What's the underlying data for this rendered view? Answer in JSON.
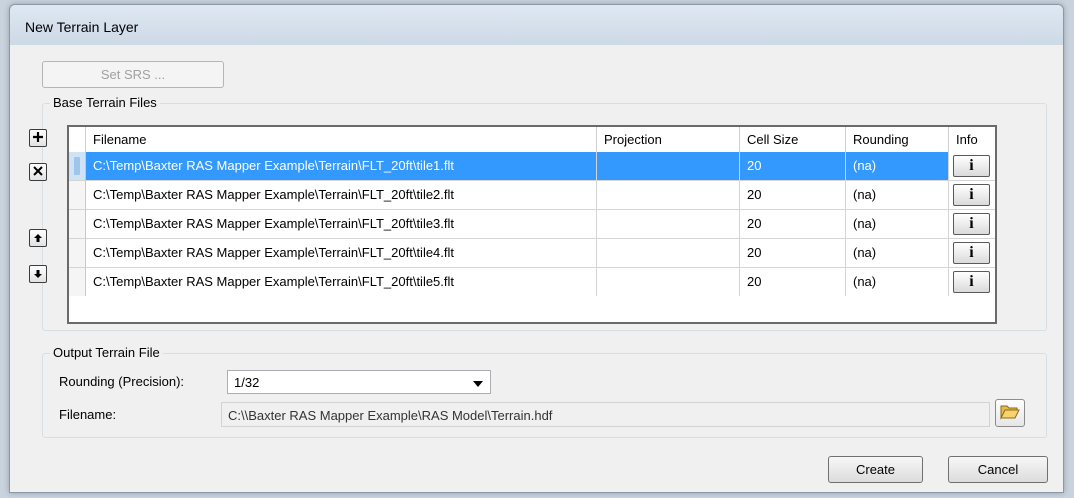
{
  "window": {
    "title": "New Terrain Layer"
  },
  "set_srs_label": "Set SRS ...",
  "base_terrain": {
    "group_label": "Base Terrain Files",
    "columns": [
      "Filename",
      "Projection",
      "Cell Size",
      "Rounding",
      "Info"
    ],
    "rows": [
      {
        "filename": "C:\\Temp\\Baxter RAS Mapper Example\\Terrain\\FLT_20ft\\tile1.flt",
        "projection": "",
        "cell_size": "20",
        "rounding": "(na)",
        "info": "i",
        "selected": true
      },
      {
        "filename": "C:\\Temp\\Baxter RAS Mapper Example\\Terrain\\FLT_20ft\\tile2.flt",
        "projection": "",
        "cell_size": "20",
        "rounding": "(na)",
        "info": "i",
        "selected": false
      },
      {
        "filename": "C:\\Temp\\Baxter RAS Mapper Example\\Terrain\\FLT_20ft\\tile3.flt",
        "projection": "",
        "cell_size": "20",
        "rounding": "(na)",
        "info": "i",
        "selected": false
      },
      {
        "filename": "C:\\Temp\\Baxter RAS Mapper Example\\Terrain\\FLT_20ft\\tile4.flt",
        "projection": "",
        "cell_size": "20",
        "rounding": "(na)",
        "info": "i",
        "selected": false
      },
      {
        "filename": "C:\\Temp\\Baxter RAS Mapper Example\\Terrain\\FLT_20ft\\tile5.flt",
        "projection": "",
        "cell_size": "20",
        "rounding": "(na)",
        "info": "i",
        "selected": false
      }
    ],
    "side_icons": [
      "add-icon",
      "remove-icon",
      "move-up-icon",
      "move-down-icon"
    ]
  },
  "output": {
    "group_label": "Output Terrain File",
    "rounding_label": "Rounding (Precision):",
    "rounding_value": "1/32",
    "filename_label": "Filename:",
    "filename_value": "C:\\\\Baxter RAS Mapper Example\\RAS Model\\Terrain.hdf",
    "browse_icon": "folder-open-icon"
  },
  "buttons": {
    "create": "Create",
    "cancel": "Cancel"
  },
  "colors": {
    "selection": "#3399ff",
    "background": "#f0f0f0"
  }
}
